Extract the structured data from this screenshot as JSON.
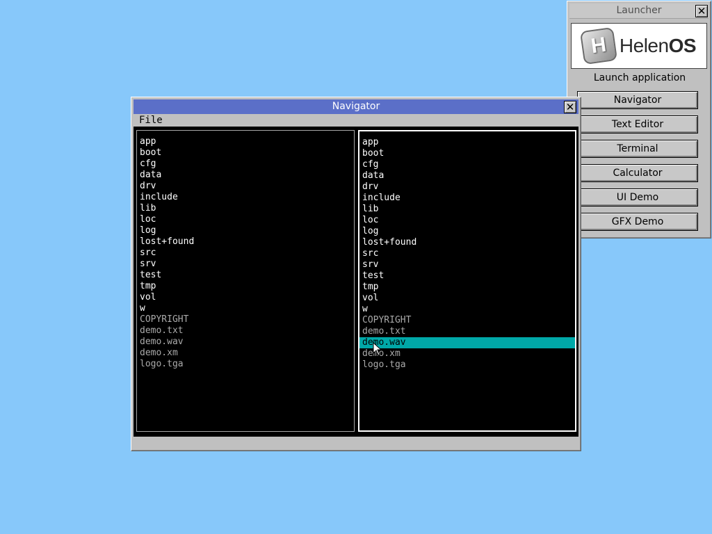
{
  "launcher": {
    "title": "Launcher",
    "close_icon": "✕",
    "logo_letter": "H",
    "brand_helen": "Helen",
    "brand_os": "OS",
    "subtitle": "Launch application",
    "buttons": [
      "Navigator",
      "Text Editor",
      "Terminal",
      "Calculator",
      "UI Demo",
      "GFX Demo"
    ]
  },
  "navigator": {
    "title": "Navigator",
    "close_icon": "✕",
    "menu": [
      "File"
    ],
    "left_panel": {
      "dirs": [
        "app",
        "boot",
        "cfg",
        "data",
        "drv",
        "include",
        "lib",
        "loc",
        "log",
        "lost+found",
        "src",
        "srv",
        "test",
        "tmp",
        "vol",
        "w"
      ],
      "files": [
        "COPYRIGHT",
        "demo.txt",
        "demo.wav",
        "demo.xm",
        "logo.tga"
      ]
    },
    "right_panel": {
      "dirs": [
        "app",
        "boot",
        "cfg",
        "data",
        "drv",
        "include",
        "lib",
        "loc",
        "log",
        "lost+found",
        "src",
        "srv",
        "test",
        "tmp",
        "vol",
        "w"
      ],
      "files": [
        "COPYRIGHT",
        "demo.txt",
        "demo.wav",
        "demo.xm",
        "logo.tga"
      ],
      "selected": "demo.wav"
    }
  },
  "colors": {
    "desktop": "#87c8fa",
    "active_titlebar": "#5b6fc8",
    "selection": "#00a8a8"
  }
}
